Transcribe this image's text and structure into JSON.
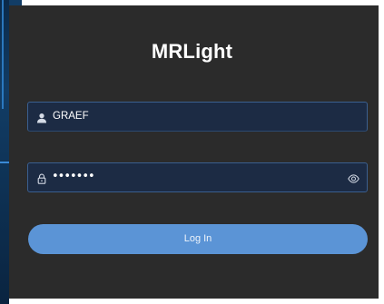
{
  "app": {
    "title": "MRLight"
  },
  "login": {
    "username_value": "GRAEF",
    "password_masked": "•••••••",
    "submit_label": "Log In"
  },
  "colors": {
    "panel_bg": "#2b2b2b",
    "field_bg": "#1c2b44",
    "field_border": "#3a5f8f",
    "button_bg": "#5b94d6",
    "accent_blue": "#2f7fc9"
  },
  "icons": {
    "username": "user-icon",
    "password": "lock-icon",
    "visibility": "eye-icon"
  }
}
